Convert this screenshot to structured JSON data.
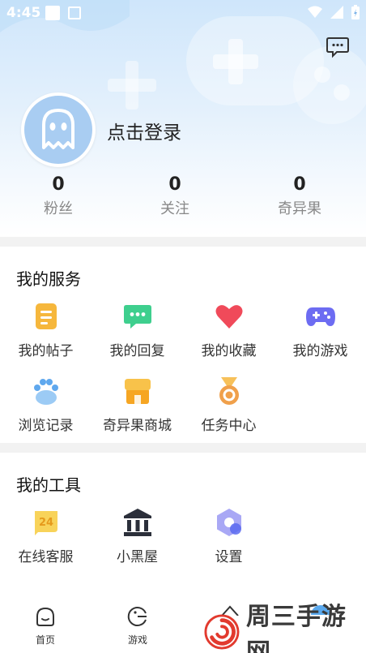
{
  "status_bar": {
    "time": "4:45"
  },
  "profile": {
    "login_text": "点击登录"
  },
  "stats": [
    {
      "value": "0",
      "label": "粉丝"
    },
    {
      "value": "0",
      "label": "关注"
    },
    {
      "value": "0",
      "label": "奇异果"
    }
  ],
  "services": {
    "title": "我的服务",
    "items": [
      {
        "label": "我的帖子",
        "icon": "post-icon"
      },
      {
        "label": "我的回复",
        "icon": "reply-icon"
      },
      {
        "label": "我的收藏",
        "icon": "favorite-heart-icon"
      },
      {
        "label": "我的游戏",
        "icon": "gamepad-icon"
      },
      {
        "label": "浏览记录",
        "icon": "paw-icon"
      },
      {
        "label": "奇异果商城",
        "icon": "shop-icon"
      },
      {
        "label": "任务中心",
        "icon": "medal-icon"
      }
    ]
  },
  "tools": {
    "title": "我的工具",
    "items": [
      {
        "label": "在线客服",
        "icon": "customer-service-icon",
        "badge": "24"
      },
      {
        "label": "小黑屋",
        "icon": "building-icon"
      },
      {
        "label": "设置",
        "icon": "settings-hexagon-icon"
      }
    ]
  },
  "tab_bar": [
    {
      "label": "首页",
      "icon": "home-icon"
    },
    {
      "label": "游戏",
      "icon": "game-icon"
    }
  ],
  "watermark": {
    "text": "周三手游网"
  },
  "colors": {
    "hero_top": "#cfe6fb",
    "avatar": "#a9cdf2",
    "post": "#f6b73c",
    "reply": "#3ecf8e",
    "heart": "#f04a5a",
    "gamepad": "#6d6cf2",
    "paw": "#5fa8ee",
    "shop": "#f6a623",
    "medal": "#f0a04b",
    "watermark_red": "#e23a2e"
  }
}
